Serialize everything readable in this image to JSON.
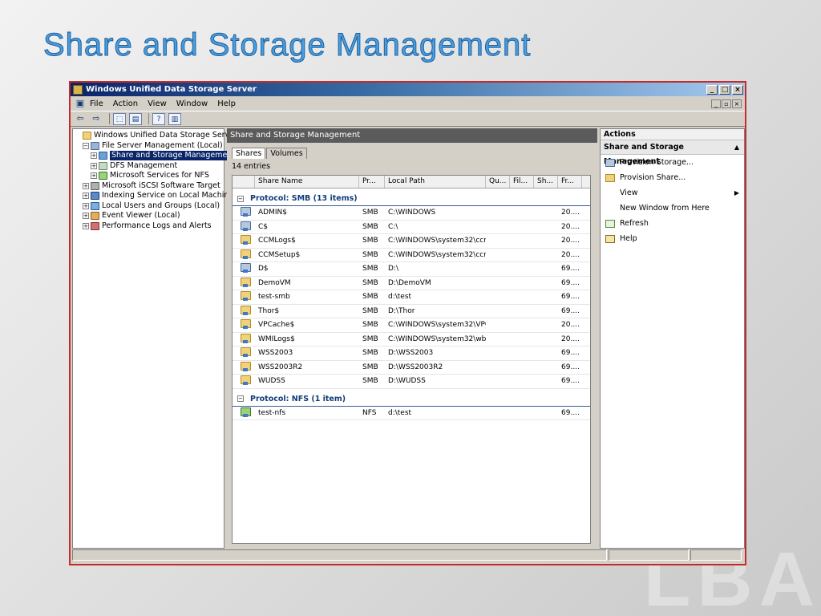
{
  "slide": {
    "title": "Share and Storage Management",
    "watermark": "LBA"
  },
  "window": {
    "title": "Windows Unified Data Storage Server",
    "buttons": {
      "minimize": "_",
      "maximize": "□",
      "close": "×"
    },
    "menu": [
      "File",
      "Action",
      "View",
      "Window",
      "Help"
    ],
    "mdi_buttons": [
      "_",
      "▫",
      "×"
    ],
    "toolbar": {
      "back": "⇦",
      "forward": "⇨",
      "up": "⬚",
      "props": "▤",
      "help": "?",
      "show": "▥"
    }
  },
  "tree": [
    {
      "label": "Windows Unified Data Storage Server",
      "indent": 0,
      "expander": "",
      "icon": "folder"
    },
    {
      "label": "File Server Management (Local)",
      "indent": 1,
      "expander": "−",
      "icon": "server"
    },
    {
      "label": "Share and Storage Management",
      "indent": 2,
      "expander": "+",
      "icon": "share",
      "selected": true
    },
    {
      "label": "DFS Management",
      "indent": 2,
      "expander": "+",
      "icon": "dfs"
    },
    {
      "label": "Microsoft Services for NFS",
      "indent": 2,
      "expander": "+",
      "icon": "nfs"
    },
    {
      "label": "Microsoft iSCSI Software Target",
      "indent": 1,
      "expander": "+",
      "icon": "iscsi"
    },
    {
      "label": "Indexing Service on Local Machine",
      "indent": 1,
      "expander": "+",
      "icon": "index"
    },
    {
      "label": "Local Users and Groups (Local)",
      "indent": 1,
      "expander": "+",
      "icon": "users"
    },
    {
      "label": "Event Viewer (Local)",
      "indent": 1,
      "expander": "+",
      "icon": "event"
    },
    {
      "label": "Performance Logs and Alerts",
      "indent": 1,
      "expander": "+",
      "icon": "perf"
    }
  ],
  "center": {
    "header": "Share and Storage Management",
    "tabs": [
      "Shares",
      "Volumes"
    ],
    "entries": "14 entries",
    "columns": [
      "Share Name",
      "Pr...",
      "Local Path",
      "Qu...",
      "Fil...",
      "Sh...",
      "Fr..."
    ],
    "groups": [
      {
        "label": "Protocol: SMB (13 items)",
        "rows": [
          {
            "name": "ADMIN$",
            "protocol": "SMB",
            "path": "C:\\WINDOWS",
            "free": "20....",
            "icon": "drive"
          },
          {
            "name": "C$",
            "protocol": "SMB",
            "path": "C:\\",
            "free": "20....",
            "icon": "drive"
          },
          {
            "name": "CCMLogs$",
            "protocol": "SMB",
            "path": "C:\\WINDOWS\\system32\\ccm...",
            "free": "20....",
            "icon": "folder"
          },
          {
            "name": "CCMSetup$",
            "protocol": "SMB",
            "path": "C:\\WINDOWS\\system32\\ccm...",
            "free": "20....",
            "icon": "folder"
          },
          {
            "name": "D$",
            "protocol": "SMB",
            "path": "D:\\",
            "free": "69....",
            "icon": "drive"
          },
          {
            "name": "DemoVM",
            "protocol": "SMB",
            "path": "D:\\DemoVM",
            "free": "69....",
            "icon": "folder"
          },
          {
            "name": "test-smb",
            "protocol": "SMB",
            "path": "d:\\test",
            "free": "69....",
            "icon": "folder"
          },
          {
            "name": "Thor$",
            "protocol": "SMB",
            "path": "D:\\Thor",
            "free": "69....",
            "icon": "folder"
          },
          {
            "name": "VPCache$",
            "protocol": "SMB",
            "path": "C:\\WINDOWS\\system32\\VPC...",
            "free": "20....",
            "icon": "folder"
          },
          {
            "name": "WMILogs$",
            "protocol": "SMB",
            "path": "C:\\WINDOWS\\system32\\wb...",
            "free": "20....",
            "icon": "folder"
          },
          {
            "name": "WSS2003",
            "protocol": "SMB",
            "path": "D:\\WSS2003",
            "free": "69....",
            "icon": "folder"
          },
          {
            "name": "WSS2003R2",
            "protocol": "SMB",
            "path": "D:\\WSS2003R2",
            "free": "69....",
            "icon": "folder"
          },
          {
            "name": "WUDSS",
            "protocol": "SMB",
            "path": "D:\\WUDSS",
            "free": "69....",
            "icon": "folder"
          }
        ]
      },
      {
        "label": "Protocol: NFS (1 item)",
        "rows": [
          {
            "name": "test-nfs",
            "protocol": "NFS",
            "path": "d:\\test",
            "free": "69....",
            "icon": "nfs"
          }
        ]
      }
    ]
  },
  "actions": {
    "title": "Actions",
    "section": "Share and Storage Management",
    "items": [
      {
        "label": "Provision Storage...",
        "icon": "storage"
      },
      {
        "label": "Provision Share...",
        "icon": "share"
      },
      {
        "label": "View",
        "icon": "none",
        "submenu": true
      },
      {
        "label": "New Window from Here",
        "icon": "none"
      },
      {
        "label": "Refresh",
        "icon": "refresh"
      },
      {
        "label": "Help",
        "icon": "help"
      }
    ]
  }
}
